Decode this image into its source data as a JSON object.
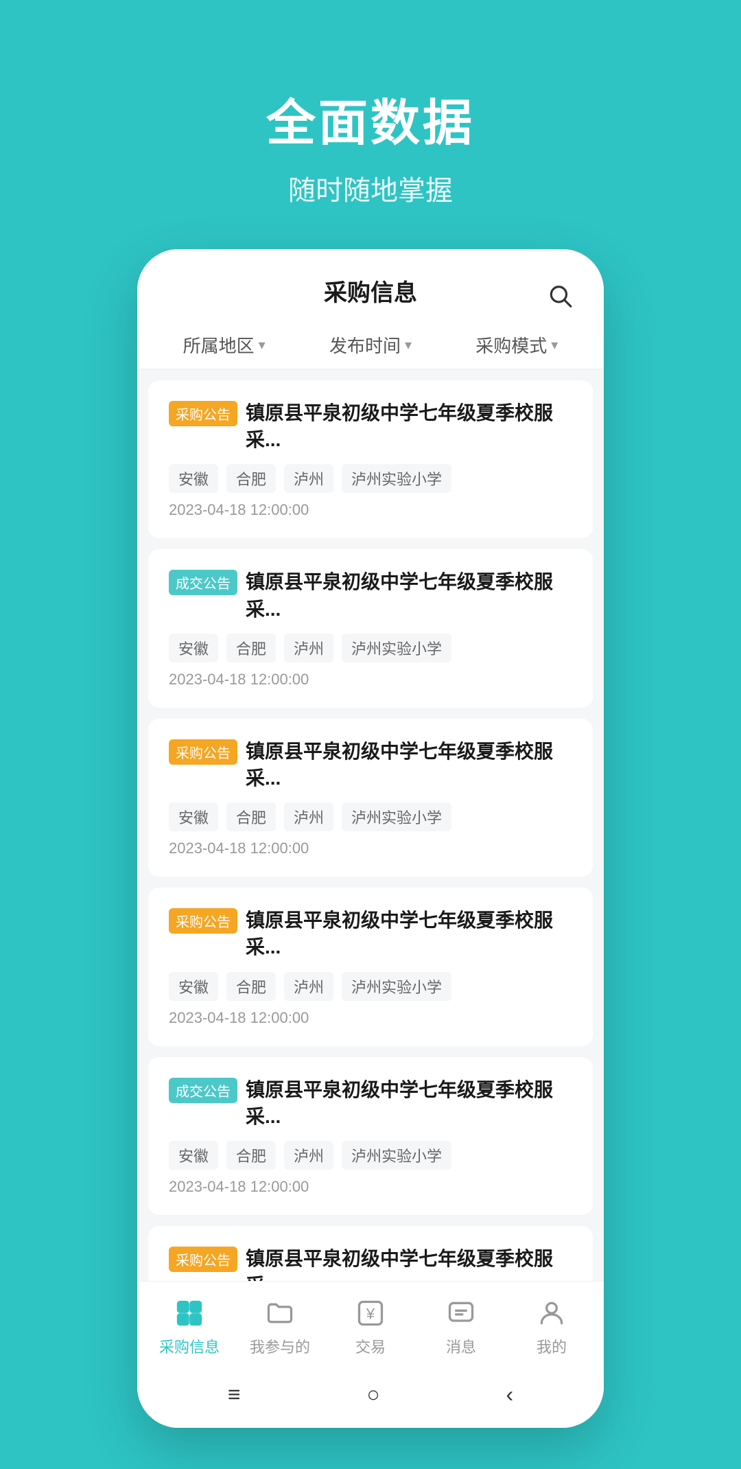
{
  "header": {
    "title": "全面数据",
    "subtitle": "随时随地掌握"
  },
  "app_bar": {
    "title": "采购信息"
  },
  "filters": [
    {
      "label": "所属地区"
    },
    {
      "label": "发布时间"
    },
    {
      "label": "采购模式"
    }
  ],
  "items": [
    {
      "badge": "采购公告",
      "badge_type": "purchase",
      "title": "镇原县平泉初级中学七年级夏季校服采...",
      "tags": [
        "安徽",
        "合肥",
        "泸州",
        "泸州实验小学"
      ],
      "time": "2023-04-18 12:00:00"
    },
    {
      "badge": "成交公告",
      "badge_type": "deal",
      "title": "镇原县平泉初级中学七年级夏季校服采...",
      "tags": [
        "安徽",
        "合肥",
        "泸州",
        "泸州实验小学"
      ],
      "time": "2023-04-18 12:00:00"
    },
    {
      "badge": "采购公告",
      "badge_type": "purchase",
      "title": "镇原县平泉初级中学七年级夏季校服采...",
      "tags": [
        "安徽",
        "合肥",
        "泸州",
        "泸州实验小学"
      ],
      "time": "2023-04-18 12:00:00"
    },
    {
      "badge": "采购公告",
      "badge_type": "purchase",
      "title": "镇原县平泉初级中学七年级夏季校服采...",
      "tags": [
        "安徽",
        "合肥",
        "泸州",
        "泸州实验小学"
      ],
      "time": "2023-04-18 12:00:00"
    },
    {
      "badge": "成交公告",
      "badge_type": "deal",
      "title": "镇原县平泉初级中学七年级夏季校服采...",
      "tags": [
        "安徽",
        "合肥",
        "泸州",
        "泸州实验小学"
      ],
      "time": "2023-04-18 12:00:00"
    },
    {
      "badge": "采购公告",
      "badge_type": "purchase",
      "title": "镇原县平泉初级中学七年级夏季校服采...",
      "tags": [],
      "time": ""
    }
  ],
  "bottom_nav": [
    {
      "label": "采购信息",
      "icon": "home-icon",
      "active": true
    },
    {
      "label": "我参与的",
      "icon": "folder-icon",
      "active": false
    },
    {
      "label": "交易",
      "icon": "yuan-icon",
      "active": false
    },
    {
      "label": "消息",
      "icon": "message-icon",
      "active": false
    },
    {
      "label": "我的",
      "icon": "user-icon",
      "active": false
    }
  ],
  "system_nav": {
    "menu": "≡",
    "home": "○",
    "back": "‹"
  }
}
